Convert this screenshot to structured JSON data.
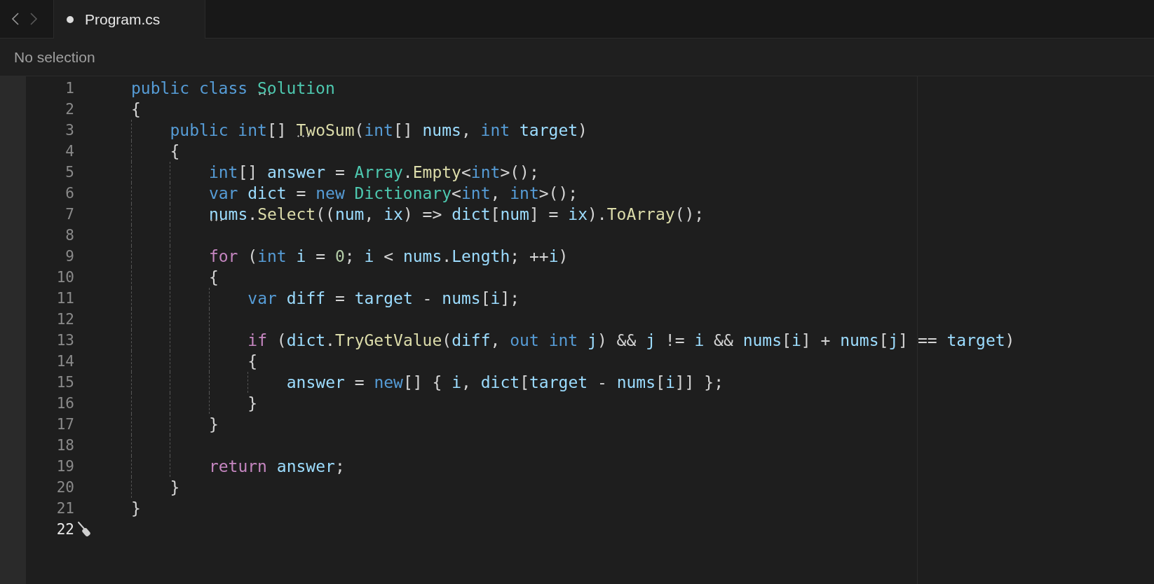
{
  "nav": [
    {
      "kind": "back",
      "disabled": false
    },
    {
      "kind": "forward",
      "disabled": true
    }
  ],
  "tabs": [
    {
      "label": "Program.cs",
      "selected": true,
      "modified": true
    }
  ],
  "breadcrumb": "No selection",
  "editor": {
    "lines": [
      {
        "number": "1",
        "current": false,
        "tokens": [
          {
            "t": "public class ",
            "color": "#569cd6"
          },
          {
            "t": "Solution",
            "color": "#4ec9b0",
            "hint": true
          }
        ]
      },
      {
        "number": "2",
        "current": false,
        "tokens": [
          {
            "t": "{",
            "color": "#d4d4d4"
          }
        ]
      },
      {
        "number": "3",
        "current": false,
        "tokens": [
          {
            "t": "    public int",
            "color": "#569cd6"
          },
          {
            "t": "[] ",
            "color": "#d4d4d4"
          },
          {
            "t": "TwoSum",
            "color": "#dcdcaa",
            "hint": true
          },
          {
            "t": "(",
            "color": "#d4d4d4"
          },
          {
            "t": "int",
            "color": "#569cd6"
          },
          {
            "t": "[] ",
            "color": "#d4d4d4"
          },
          {
            "t": "nums",
            "color": "#9cdcfe"
          },
          {
            "t": ", ",
            "color": "#d4d4d4"
          },
          {
            "t": "int ",
            "color": "#569cd6"
          },
          {
            "t": "target",
            "color": "#9cdcfe"
          },
          {
            "t": ")",
            "color": "#d4d4d4"
          }
        ]
      },
      {
        "number": "4",
        "current": false,
        "tokens": [
          {
            "t": "    {",
            "color": "#d4d4d4"
          }
        ]
      },
      {
        "number": "5",
        "current": false,
        "tokens": [
          {
            "t": "        int",
            "color": "#569cd6"
          },
          {
            "t": "[] ",
            "color": "#d4d4d4"
          },
          {
            "t": "answer",
            "color": "#9cdcfe"
          },
          {
            "t": " = ",
            "color": "#d4d4d4"
          },
          {
            "t": "Array",
            "color": "#4ec9b0"
          },
          {
            "t": ".",
            "color": "#d4d4d4"
          },
          {
            "t": "Empty",
            "color": "#dcdcaa"
          },
          {
            "t": "<",
            "color": "#d4d4d4"
          },
          {
            "t": "int",
            "color": "#569cd6"
          },
          {
            "t": ">();",
            "color": "#d4d4d4"
          }
        ]
      },
      {
        "number": "6",
        "current": false,
        "tokens": [
          {
            "t": "        var ",
            "color": "#569cd6"
          },
          {
            "t": "dict",
            "color": "#9cdcfe"
          },
          {
            "t": " = ",
            "color": "#d4d4d4"
          },
          {
            "t": "new ",
            "color": "#569cd6"
          },
          {
            "t": "Dictionary",
            "color": "#4ec9b0"
          },
          {
            "t": "<",
            "color": "#d4d4d4"
          },
          {
            "t": "int",
            "color": "#569cd6"
          },
          {
            "t": ", ",
            "color": "#d4d4d4"
          },
          {
            "t": "int",
            "color": "#569cd6"
          },
          {
            "t": ">();",
            "color": "#d4d4d4"
          }
        ]
      },
      {
        "number": "7",
        "current": false,
        "tokens": [
          {
            "t": "        nums",
            "color": "#9cdcfe",
            "hint": true
          },
          {
            "t": ".",
            "color": "#d4d4d4"
          },
          {
            "t": "Select",
            "color": "#dcdcaa"
          },
          {
            "t": "((",
            "color": "#d4d4d4"
          },
          {
            "t": "num",
            "color": "#9cdcfe"
          },
          {
            "t": ", ",
            "color": "#d4d4d4"
          },
          {
            "t": "ix",
            "color": "#9cdcfe"
          },
          {
            "t": ") => ",
            "color": "#d4d4d4"
          },
          {
            "t": "dict",
            "color": "#9cdcfe"
          },
          {
            "t": "[",
            "color": "#d4d4d4"
          },
          {
            "t": "num",
            "color": "#9cdcfe"
          },
          {
            "t": "] = ",
            "color": "#d4d4d4"
          },
          {
            "t": "ix",
            "color": "#9cdcfe"
          },
          {
            "t": ").",
            "color": "#d4d4d4"
          },
          {
            "t": "ToArray",
            "color": "#dcdcaa"
          },
          {
            "t": "();",
            "color": "#d4d4d4"
          }
        ]
      },
      {
        "number": "8",
        "current": false
      },
      {
        "number": "9",
        "current": false,
        "tokens": [
          {
            "t": "        for ",
            "color": "#c586c0"
          },
          {
            "t": "(",
            "color": "#d4d4d4"
          },
          {
            "t": "int ",
            "color": "#569cd6"
          },
          {
            "t": "i",
            "color": "#9cdcfe"
          },
          {
            "t": " = ",
            "color": "#d4d4d4"
          },
          {
            "t": "0",
            "color": "#b5cea8"
          },
          {
            "t": "; ",
            "color": "#d4d4d4"
          },
          {
            "t": "i",
            "color": "#9cdcfe"
          },
          {
            "t": " < ",
            "color": "#d4d4d4"
          },
          {
            "t": "nums",
            "color": "#9cdcfe"
          },
          {
            "t": ".",
            "color": "#d4d4d4"
          },
          {
            "t": "Length",
            "color": "#9cdcfe"
          },
          {
            "t": "; ++",
            "color": "#d4d4d4"
          },
          {
            "t": "i",
            "color": "#9cdcfe"
          },
          {
            "t": ")",
            "color": "#d4d4d4"
          }
        ]
      },
      {
        "number": "10",
        "current": false,
        "tokens": [
          {
            "t": "        {",
            "color": "#d4d4d4"
          }
        ]
      },
      {
        "number": "11",
        "current": false,
        "tokens": [
          {
            "t": "            var ",
            "color": "#569cd6"
          },
          {
            "t": "diff",
            "color": "#9cdcfe"
          },
          {
            "t": " = ",
            "color": "#d4d4d4"
          },
          {
            "t": "target",
            "color": "#9cdcfe"
          },
          {
            "t": " - ",
            "color": "#d4d4d4"
          },
          {
            "t": "nums",
            "color": "#9cdcfe"
          },
          {
            "t": "[",
            "color": "#d4d4d4"
          },
          {
            "t": "i",
            "color": "#9cdcfe"
          },
          {
            "t": "];",
            "color": "#d4d4d4"
          }
        ]
      },
      {
        "number": "12",
        "current": false
      },
      {
        "number": "13",
        "current": false,
        "tokens": [
          {
            "t": "            if ",
            "color": "#c586c0"
          },
          {
            "t": "(",
            "color": "#d4d4d4"
          },
          {
            "t": "dict",
            "color": "#9cdcfe"
          },
          {
            "t": ".",
            "color": "#d4d4d4"
          },
          {
            "t": "TryGetValue",
            "color": "#dcdcaa"
          },
          {
            "t": "(",
            "color": "#d4d4d4"
          },
          {
            "t": "diff",
            "color": "#9cdcfe"
          },
          {
            "t": ", ",
            "color": "#d4d4d4"
          },
          {
            "t": "out int ",
            "color": "#569cd6"
          },
          {
            "t": "j",
            "color": "#9cdcfe"
          },
          {
            "t": ") && ",
            "color": "#d4d4d4"
          },
          {
            "t": "j",
            "color": "#9cdcfe"
          },
          {
            "t": " != ",
            "color": "#d4d4d4"
          },
          {
            "t": "i",
            "color": "#9cdcfe"
          },
          {
            "t": " && ",
            "color": "#d4d4d4"
          },
          {
            "t": "nums",
            "color": "#9cdcfe"
          },
          {
            "t": "[",
            "color": "#d4d4d4"
          },
          {
            "t": "i",
            "color": "#9cdcfe"
          },
          {
            "t": "] + ",
            "color": "#d4d4d4"
          },
          {
            "t": "nums",
            "color": "#9cdcfe"
          },
          {
            "t": "[",
            "color": "#d4d4d4"
          },
          {
            "t": "j",
            "color": "#9cdcfe"
          },
          {
            "t": "] == ",
            "color": "#d4d4d4"
          },
          {
            "t": "target",
            "color": "#9cdcfe"
          },
          {
            "t": ")",
            "color": "#d4d4d4"
          }
        ]
      },
      {
        "number": "14",
        "current": false,
        "tokens": [
          {
            "t": "            {",
            "color": "#d4d4d4"
          }
        ]
      },
      {
        "number": "15",
        "current": false,
        "tokens": [
          {
            "t": "                answer",
            "color": "#9cdcfe"
          },
          {
            "t": " = ",
            "color": "#d4d4d4"
          },
          {
            "t": "new",
            "color": "#569cd6"
          },
          {
            "t": "[] { ",
            "color": "#d4d4d4"
          },
          {
            "t": "i",
            "color": "#9cdcfe"
          },
          {
            "t": ", ",
            "color": "#d4d4d4"
          },
          {
            "t": "dict",
            "color": "#9cdcfe"
          },
          {
            "t": "[",
            "color": "#d4d4d4"
          },
          {
            "t": "target",
            "color": "#9cdcfe"
          },
          {
            "t": " - ",
            "color": "#d4d4d4"
          },
          {
            "t": "nums",
            "color": "#9cdcfe"
          },
          {
            "t": "[",
            "color": "#d4d4d4"
          },
          {
            "t": "i",
            "color": "#9cdcfe"
          },
          {
            "t": "]] };",
            "color": "#d4d4d4"
          }
        ]
      },
      {
        "number": "16",
        "current": false,
        "tokens": [
          {
            "t": "            }",
            "color": "#d4d4d4"
          }
        ]
      },
      {
        "number": "17",
        "current": false,
        "tokens": [
          {
            "t": "        }",
            "color": "#d4d4d4"
          }
        ]
      },
      {
        "number": "18",
        "current": false
      },
      {
        "number": "19",
        "current": false,
        "tokens": [
          {
            "t": "        return ",
            "color": "#c586c0"
          },
          {
            "t": "answer",
            "color": "#9cdcfe"
          },
          {
            "t": ";",
            "color": "#d4d4d4"
          }
        ]
      },
      {
        "number": "20",
        "current": false,
        "tokens": [
          {
            "t": "    }",
            "color": "#d4d4d4"
          }
        ]
      },
      {
        "number": "21",
        "current": false,
        "tokens": [
          {
            "t": "}",
            "color": "#d4d4d4"
          }
        ]
      },
      {
        "number": "22",
        "current": true
      }
    ]
  }
}
